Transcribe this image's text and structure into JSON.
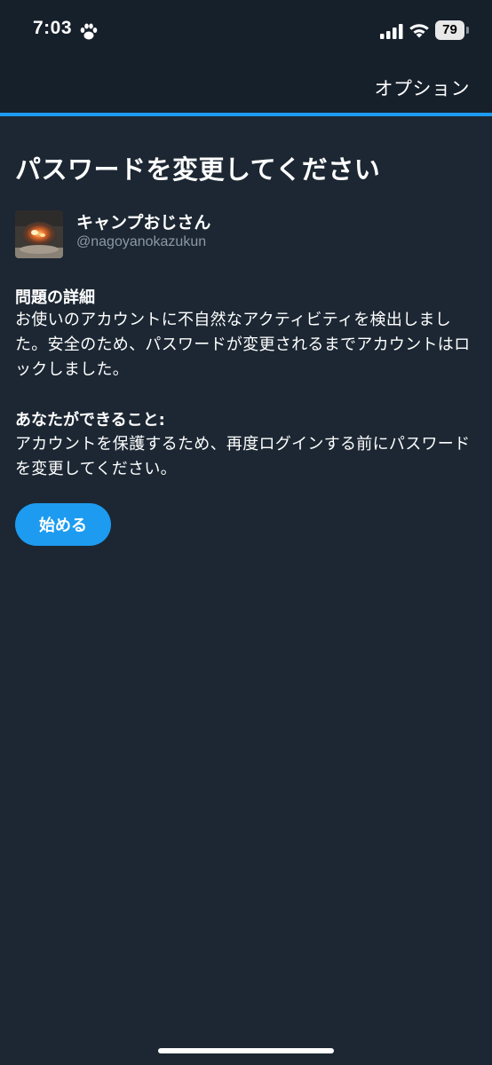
{
  "status_bar": {
    "time": "7:03",
    "battery": "79"
  },
  "header": {
    "options_label": "オプション"
  },
  "page": {
    "title": "パスワードを変更してください"
  },
  "account": {
    "display_name": "キャンプおじさん",
    "handle": "@nagoyanokazukun"
  },
  "problem": {
    "heading": "問題の詳細",
    "body": "お使いのアカウントに不自然なアクティビティを検出しました。安全のため、パスワードが変更されるまでアカウントはロックしました。"
  },
  "action": {
    "heading": "あなたができること:",
    "body": "アカウントを保護するため、再度ログインする前にパスワードを変更してください。"
  },
  "buttons": {
    "start_label": "始める"
  },
  "colors": {
    "background": "#1c2733",
    "header_background": "#16202b",
    "accent": "#1d9bf0",
    "secondary_text": "#8b98a5"
  }
}
